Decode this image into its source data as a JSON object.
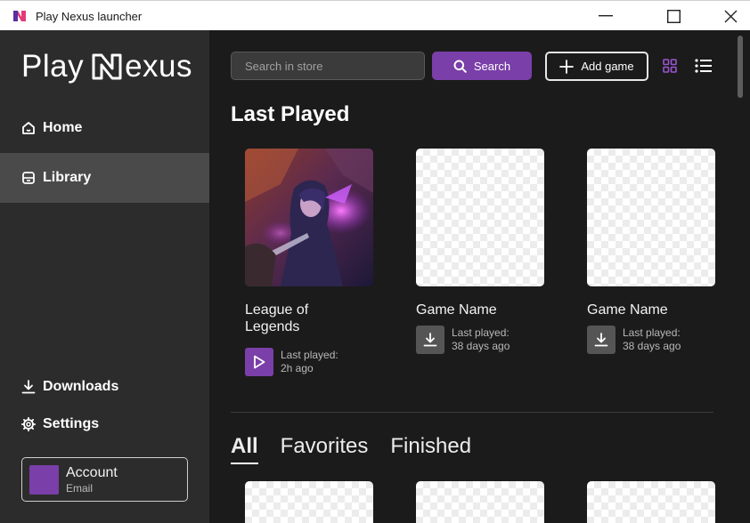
{
  "window": {
    "title": "Play Nexus launcher",
    "controls": [
      "minimize",
      "maximize",
      "close"
    ]
  },
  "sidebar": {
    "brand_left": "Play",
    "brand_right": "exus",
    "nav": [
      {
        "label": "Home",
        "icon": "home-icon",
        "active": false
      },
      {
        "label": "Library",
        "icon": "library-icon",
        "active": true
      }
    ],
    "bottom_nav": [
      {
        "label": "Downloads",
        "icon": "download-icon"
      },
      {
        "label": "Settings",
        "icon": "gear-icon"
      }
    ],
    "account": {
      "name": "Account",
      "email": "Email"
    }
  },
  "toolbar": {
    "search_placeholder": "Search in store",
    "search_label": "Search",
    "add_game_label": "Add game",
    "view_modes": [
      "grid-view-icon",
      "list-view-icon"
    ]
  },
  "last_played": {
    "title": "Last Played",
    "games": [
      {
        "name": "League of Legends",
        "last_label": "Last played:",
        "last_value": "2h ago",
        "action": "play",
        "has_art": true
      },
      {
        "name": "Game Name",
        "last_label": "Last played:",
        "last_value": "38 days ago",
        "action": "download",
        "has_art": false
      },
      {
        "name": "Game Name",
        "last_label": "Last played:",
        "last_value": "38 days ago",
        "action": "download",
        "has_art": false
      }
    ]
  },
  "filters": {
    "tabs": [
      {
        "label": "All",
        "active": true
      },
      {
        "label": "Favorites",
        "active": false
      },
      {
        "label": "Finished",
        "active": false
      }
    ]
  },
  "colors": {
    "accent": "#7a3fa8",
    "sidebar_bg": "#2c2c2c",
    "main_bg": "#1b1b1b",
    "active_nav_bg": "#4a4a4a"
  }
}
